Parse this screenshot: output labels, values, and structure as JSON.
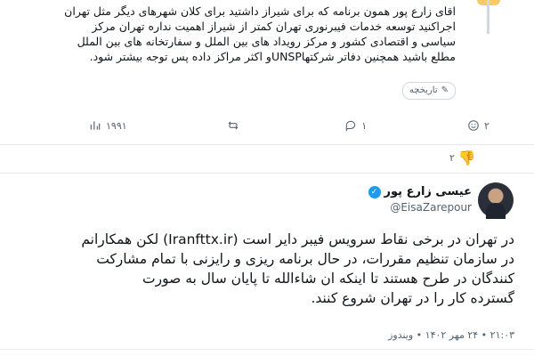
{
  "reply": {
    "lines": [
      "اقای زارع پور همون برنامه که برای شیراز داشتید برای کلان شهرهای دیگر مثل تهران",
      "اجراکنید توسعه خدمات فیبرنوری تهران کمتر از شیراز اهمیت نداره تهران مرکز",
      "سیاسی و اقتصادی کشور و مرکز رویداد های بین الملل و سفارتخانه های بین الملل",
      "مطلع باشید همچنین دفاتر شرکتهاUNSPو اکثر مراکز داده پس توجه بیشتر شود."
    ],
    "history_label": "تاریخچه",
    "actions": {
      "views": "۱۹۹۱",
      "retweets": "",
      "replies": "۱",
      "likes": "۲"
    }
  },
  "reaction_badge": {
    "count": "۲"
  },
  "tweet": {
    "display_name": "عیسی زارع پور",
    "handle": "@EisaZarepour",
    "lines": [
      "در تهران در برخی نقاط سرویس فیبر دایر است (Iranfttx.ir) لکن همکارانم",
      "در سازمان تنظیم مقررات، در حال برنامه ریزی و رایزنی با تمام مشارکت",
      "کنندگان در طرح هستند تا اینکه ان شاءالله  تا پایان سال به صورت",
      "گسترده کار را در تهران شروع کنند."
    ],
    "meta": "۲۱:۰۳ • ۲۴ مهر ۱۴۰۲ • ویندوز"
  },
  "colors": {
    "text": "#0f1419",
    "muted": "#536471",
    "verified": "#1d9bf0",
    "thumb": "#e8a11e"
  }
}
